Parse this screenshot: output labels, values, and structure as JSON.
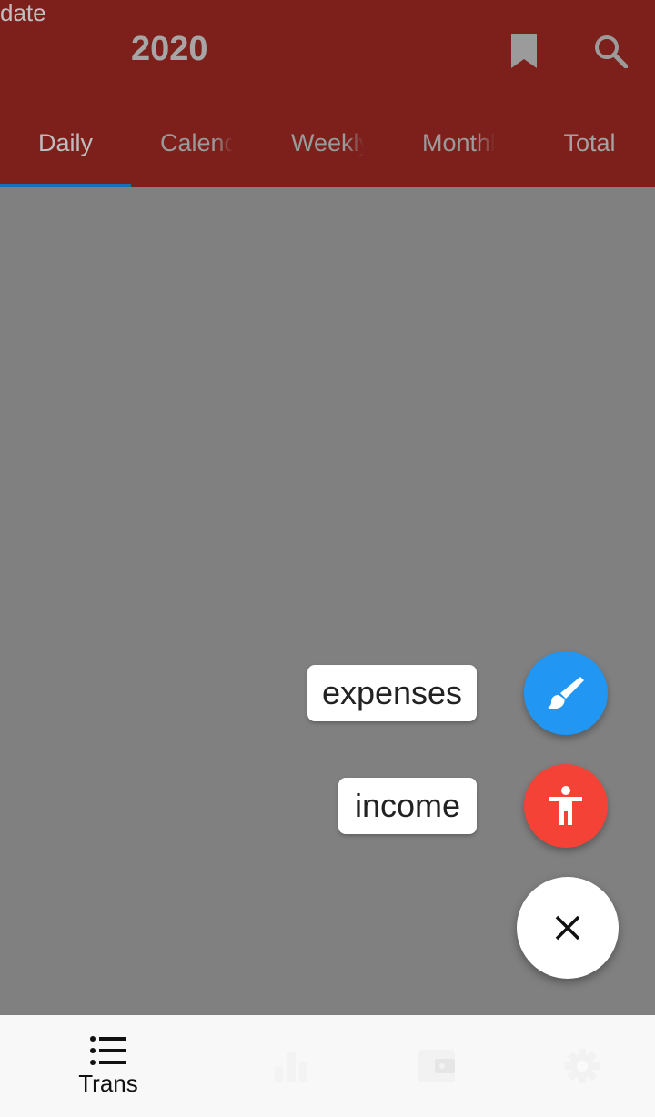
{
  "header": {
    "date_label": "date",
    "year": "2020",
    "bookmark_icon": "bookmark-icon",
    "search_icon": "search-icon"
  },
  "tabs": [
    {
      "label": "Daily",
      "active": true
    },
    {
      "label": "Calendar",
      "active": false
    },
    {
      "label": "Weekly",
      "active": false
    },
    {
      "label": "Monthly",
      "active": false
    },
    {
      "label": "Total",
      "active": false
    }
  ],
  "speed_dial": {
    "expenses_label": "expenses",
    "expenses_icon": "brush-icon",
    "income_label": "income",
    "income_icon": "accessibility-icon",
    "close_icon": "close-icon"
  },
  "bottom_nav": [
    {
      "label": "Trans",
      "icon": "list-icon",
      "active": true
    },
    {
      "label": "",
      "icon": "bar-chart-icon",
      "active": false
    },
    {
      "label": "",
      "icon": "wallet-icon",
      "active": false
    },
    {
      "label": "",
      "icon": "gear-icon",
      "active": false
    }
  ],
  "colors": {
    "appbar": "#7d201c",
    "tab_indicator": "#1d6fb3",
    "scrim": "#808080",
    "expenses_fab": "#2196f3",
    "income_fab": "#f44336"
  }
}
